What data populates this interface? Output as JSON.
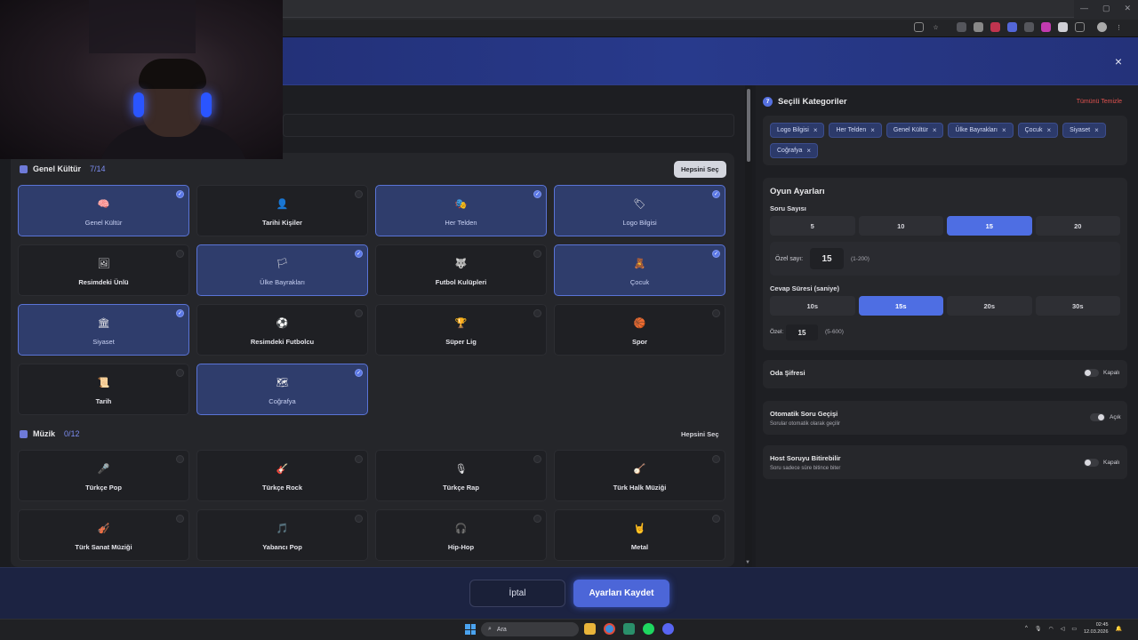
{
  "modal": {
    "close_icon": "×"
  },
  "general": {
    "title": "Genel Kültür",
    "count": "7/14",
    "select_all": "Hepsini Seç",
    "items": [
      {
        "label": "Genel Kültür",
        "selected": true,
        "icon": "🧠"
      },
      {
        "label": "Tarihi Kişiler",
        "selected": false,
        "icon": "👤"
      },
      {
        "label": "Her Telden",
        "selected": true,
        "icon": "🎭"
      },
      {
        "label": "Logo Bilgisi",
        "selected": true,
        "icon": "🏷"
      },
      {
        "label": "Resimdeki Ünlü",
        "selected": false,
        "icon": "🖼"
      },
      {
        "label": "Ülke Bayrakları",
        "selected": true,
        "icon": "🏳"
      },
      {
        "label": "Futbol Kulüpleri",
        "selected": false,
        "icon": "🐺"
      },
      {
        "label": "Çocuk",
        "selected": true,
        "icon": "🧸"
      },
      {
        "label": "Siyaset",
        "selected": true,
        "icon": "🏛"
      },
      {
        "label": "Resimdeki Futbolcu",
        "selected": false,
        "icon": "⚽"
      },
      {
        "label": "Süper Lig",
        "selected": false,
        "icon": "🏆"
      },
      {
        "label": "Spor",
        "selected": false,
        "icon": "🏀"
      },
      {
        "label": "Tarih",
        "selected": false,
        "icon": "📜"
      },
      {
        "label": "Coğrafya",
        "selected": true,
        "icon": "🗺"
      }
    ]
  },
  "music": {
    "title": "Müzik",
    "count": "0/12",
    "select_all": "Hepsini Seç",
    "items": [
      {
        "label": "Türkçe Pop",
        "selected": false,
        "icon": "🎤"
      },
      {
        "label": "Türkçe Rock",
        "selected": false,
        "icon": "🎸"
      },
      {
        "label": "Türkçe Rap",
        "selected": false,
        "icon": "🎙"
      },
      {
        "label": "Türk Halk Müziği",
        "selected": false,
        "icon": "🪕"
      },
      {
        "label": "Türk Sanat Müziği",
        "selected": false,
        "icon": "🎻"
      },
      {
        "label": "Yabancı Pop",
        "selected": false,
        "icon": "🎵"
      },
      {
        "label": "Hip-Hop",
        "selected": false,
        "icon": "🎧"
      },
      {
        "label": "Metal",
        "selected": false,
        "icon": "🤘"
      }
    ]
  },
  "selected": {
    "badge": "7",
    "title": "Seçili Kategoriler",
    "clear": "Tümünü Temizle",
    "tags": [
      "Logo Bilgisi",
      "Her Telden",
      "Genel Kültür",
      "Ülke Bayrakları",
      "Çocuk",
      "Siyaset",
      "Coğrafya"
    ]
  },
  "game": {
    "title": "Oyun Ayarları",
    "q_label": "Soru Sayısı",
    "q_options": [
      "5",
      "10",
      "15",
      "20"
    ],
    "q_active": 2,
    "custom_label": "Özel sayı:",
    "custom_value": "15",
    "custom_hint": "(1-200)",
    "t_label": "Cevap Süresi (saniye)",
    "t_options": [
      "10s",
      "15s",
      "20s",
      "30s"
    ],
    "t_active": 1,
    "custom2_label": "Özel:",
    "custom2_value": "15",
    "custom2_hint": "(5-600)"
  },
  "options": [
    {
      "title": "Oda Şifresi",
      "desc": "",
      "state": "Kapalı",
      "on": false
    },
    {
      "title": "Otomatik Soru Geçişi",
      "desc": "Sorular otomatik olarak geçilir",
      "state": "Açık",
      "on": true
    },
    {
      "title": "Host Soruyu Bitirebilir",
      "desc": "Soru sadece süre bitince biter",
      "state": "Kapalı",
      "on": false
    }
  ],
  "footer": {
    "cancel": "İptal",
    "save": "Ayarları Kaydet"
  },
  "taskbar": {
    "search": "Ara",
    "time": "02:45",
    "date": "12.03.2026"
  }
}
